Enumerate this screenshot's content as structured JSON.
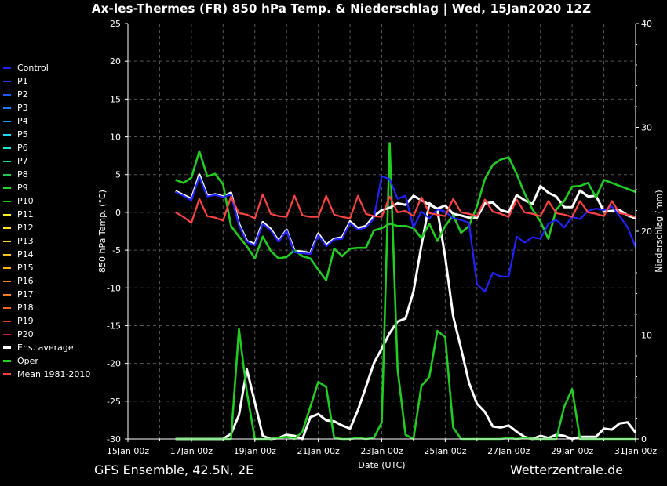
{
  "title": "Ax-les-Thermes  (FR)  850 hPa Temp. & Niederschlag | Wed, 15Jan2020 12Z",
  "footer_left": "GFS Ensemble, 42.5N, 2E",
  "footer_right": "Wetterzentrale.de",
  "chart_data": {
    "type": "line",
    "xlabel": "Date (UTC)",
    "ylabel_left": "850 hPa Temp. (°C)",
    "ylabel_right": "Niederschlag (mm)",
    "ylim_left": [
      -30,
      25
    ],
    "ylim_right": [
      0,
      40
    ],
    "yticks_left": [
      25,
      20,
      15,
      10,
      5,
      0,
      -5,
      -10,
      -15,
      -20,
      -25,
      -30
    ],
    "yticks_right": [
      40,
      30,
      20,
      10,
      0
    ],
    "xlim_days": [
      0,
      16
    ],
    "xticks": [
      "15Jan 00z",
      "17Jan 00z",
      "19Jan 00z",
      "21Jan 00z",
      "23Jan 00z",
      "25Jan 00z",
      "27Jan 00z",
      "29Jan 00z",
      "31Jan 00z"
    ],
    "grid": true,
    "legend_position": "left, outside plot",
    "x_days": [
      1.5,
      1.75,
      2,
      2.25,
      2.5,
      2.75,
      3,
      3.25,
      3.5,
      3.75,
      4,
      4.25,
      4.5,
      4.75,
      5,
      5.25,
      5.5,
      5.75,
      6,
      6.25,
      6.5,
      6.75,
      7,
      7.25,
      7.5,
      7.75,
      8,
      8.25,
      8.5,
      8.75,
      9,
      9.25,
      9.5,
      9.75,
      10,
      10.25,
      10.5,
      10.75,
      11,
      11.25,
      11.5,
      11.75,
      12,
      12.25,
      12.5,
      12.75,
      13,
      13.25,
      13.5,
      13.75,
      14,
      14.25,
      14.5,
      14.75,
      15,
      15.25,
      15.5,
      15.75,
      16
    ],
    "series": [
      {
        "name": "Ens. average",
        "color": "#ffffff",
        "kind": "temperature",
        "values": [
          2.8,
          2.3,
          1.8,
          5,
          2.2,
          2.4,
          2.1,
          2.6,
          -1.5,
          -3.8,
          -4.2,
          -1.3,
          -2.2,
          -3.8,
          -2.3,
          -5.1,
          -5.2,
          -5.4,
          -2.8,
          -4.3,
          -3.5,
          -3.3,
          -1.2,
          -2.1,
          -1.8,
          -0.5,
          0.3,
          0.6,
          1.2,
          1,
          2.2,
          1.6,
          1,
          0.5,
          0.9,
          -0.2,
          -0.4,
          -0.7,
          -0.7,
          1.2,
          1.3,
          0.3,
          0,
          2.3,
          1.6,
          1.1,
          3.5,
          2.6,
          2.1,
          0.7,
          0.7,
          2.9,
          2.1,
          2.2,
          0.1,
          0.2,
          0.3,
          -0.4,
          -0.8
        ]
      },
      {
        "name": "Oper",
        "color": "#22cc22",
        "kind": "temperature",
        "values": [
          4.3,
          3.9,
          4.6,
          8.1,
          4.8,
          5.1,
          3.7,
          -1.8,
          -3.2,
          -4.5,
          -6.1,
          -3.2,
          -5.1,
          -6.1,
          -5.9,
          -5,
          -5.8,
          -6.1,
          -7.6,
          -9,
          -4.8,
          -5.8,
          -4.8,
          -4.7,
          -4.7,
          -2.4,
          -2.1,
          -1.5,
          -1.8,
          -1.8,
          -2.1,
          -3.4,
          -1.5,
          -3.8,
          -1.8,
          -0.4,
          -2.7,
          -1.8,
          0.8,
          4.4,
          6.3,
          7,
          7.3,
          5.1,
          2.5,
          0.4,
          -1.2,
          -3.5,
          0.4,
          1.5,
          3.4,
          3.5,
          3.9,
          2,
          4.3,
          3.9,
          3.5,
          3.1,
          2.7
        ]
      },
      {
        "name": "Control",
        "color": "#2222ff",
        "kind": "temperature",
        "values": [
          2.7,
          2.2,
          1.6,
          4.7,
          2.1,
          2.3,
          2,
          2.4,
          -1.7,
          -3.9,
          -4.4,
          -1.5,
          -2.4,
          -3.9,
          -2.4,
          -5.3,
          -5.4,
          -5.5,
          -3,
          -4.5,
          -3.6,
          -3.5,
          -1.4,
          -2.3,
          -2,
          -0.8,
          4.8,
          4.4,
          1.8,
          2.2,
          -2,
          0.1,
          -0.8,
          0.4,
          0.1,
          -0.8,
          -1,
          -1.4,
          -9.5,
          -10.5,
          -8,
          -8.5,
          -8.5,
          -3.2,
          -4,
          -3.3,
          -3.5,
          -1.5,
          -1,
          -2,
          -0.6,
          -0.9,
          0.2,
          0.5,
          0.3,
          0.8,
          -0.5,
          -2,
          -4.6
        ]
      },
      {
        "name": "Mean 1981-2010",
        "color": "#ff4444",
        "kind": "temperature",
        "values": [
          0,
          -0.6,
          -1.4,
          1.8,
          -0.5,
          -0.7,
          -1.1,
          2.1,
          -0.1,
          -0.3,
          -0.8,
          2.4,
          -0.2,
          -0.5,
          -0.6,
          2.2,
          -0.4,
          -0.6,
          -0.6,
          2.2,
          -0.3,
          -0.6,
          -0.8,
          2.2,
          -0.2,
          -0.5,
          -0.6,
          2.1,
          0,
          0.2,
          -0.5,
          2,
          -0.1,
          -0.3,
          -0.5,
          1.8,
          0,
          -0.2,
          -0.5,
          1.7,
          0.1,
          -0.2,
          -0.6,
          1.7,
          0,
          -0.2,
          -0.5,
          1.5,
          -0.1,
          -0.3,
          -0.6,
          1.5,
          0,
          -0.2,
          -0.5,
          1.5,
          -0.1,
          -0.3,
          -0.6
        ]
      },
      {
        "name": "Ens. average precipitation",
        "color": "#ffffff",
        "kind": "precipitation",
        "values": [
          0,
          0,
          0,
          0,
          0,
          0,
          0,
          0.5,
          2.3,
          6.7,
          3.5,
          0.3,
          0,
          0.1,
          0.4,
          0.3,
          0,
          2.1,
          2.4,
          1.8,
          1.7,
          1.3,
          1,
          2.8,
          5,
          7.3,
          8.7,
          10.2,
          11.3,
          11.6,
          14.2,
          18.6,
          22.7,
          22.1,
          17.5,
          11.8,
          8.7,
          5.4,
          3.4,
          2.6,
          1.2,
          1.1,
          1.3,
          0.7,
          0.2,
          0,
          0.3,
          0.1,
          0.4,
          0.3,
          0,
          0.2,
          0.2,
          0.2,
          1,
          0.9,
          1.5,
          1.6,
          0.6
        ]
      },
      {
        "name": "Oper precipitation",
        "color": "#22cc22",
        "kind": "precipitation",
        "values": [
          0,
          0,
          0,
          0,
          0,
          0,
          0,
          0,
          10.6,
          4.5,
          0,
          0,
          0,
          0.1,
          0.2,
          0,
          0.7,
          3.1,
          5.5,
          5,
          0.1,
          0,
          0,
          0.1,
          0,
          0.1,
          1.6,
          28.5,
          6.7,
          0.4,
          0,
          5.1,
          6,
          10.4,
          9.8,
          1.1,
          0,
          0,
          0,
          0,
          0,
          0,
          0.1,
          0,
          0.1,
          0,
          0,
          0,
          0,
          3.1,
          4.8,
          0,
          0,
          0,
          0,
          0,
          0,
          0,
          0
        ]
      }
    ]
  },
  "legend": [
    {
      "label": "Control",
      "color": "#2222ff"
    },
    {
      "label": "P1",
      "color": "#1e3cff"
    },
    {
      "label": "P2",
      "color": "#1e5cff"
    },
    {
      "label": "P3",
      "color": "#1e7cff"
    },
    {
      "label": "P4",
      "color": "#1e9cff"
    },
    {
      "label": "P5",
      "color": "#1ed8ff"
    },
    {
      "label": "P6",
      "color": "#1ee8c8"
    },
    {
      "label": "P7",
      "color": "#1ed890"
    },
    {
      "label": "P8",
      "color": "#1ec858"
    },
    {
      "label": "P9",
      "color": "#2ad02a"
    },
    {
      "label": "P10",
      "color": "#22cc22"
    },
    {
      "label": "P11",
      "color": "#ffee22"
    },
    {
      "label": "P12",
      "color": "#ffe030"
    },
    {
      "label": "P13",
      "color": "#ffd028"
    },
    {
      "label": "P14",
      "color": "#ffc020"
    },
    {
      "label": "P15",
      "color": "#ffaa10"
    },
    {
      "label": "P16",
      "color": "#ff9020"
    },
    {
      "label": "P17",
      "color": "#ff7a20"
    },
    {
      "label": "P18",
      "color": "#f06020"
    },
    {
      "label": "P19",
      "color": "#e04020"
    },
    {
      "label": "P20",
      "color": "#c82020"
    },
    {
      "label": "Ens. average",
      "color": "#ffffff"
    },
    {
      "label": "Oper",
      "color": "#22cc22"
    },
    {
      "label": "Mean 1981-2010",
      "color": "#ff4444"
    }
  ]
}
